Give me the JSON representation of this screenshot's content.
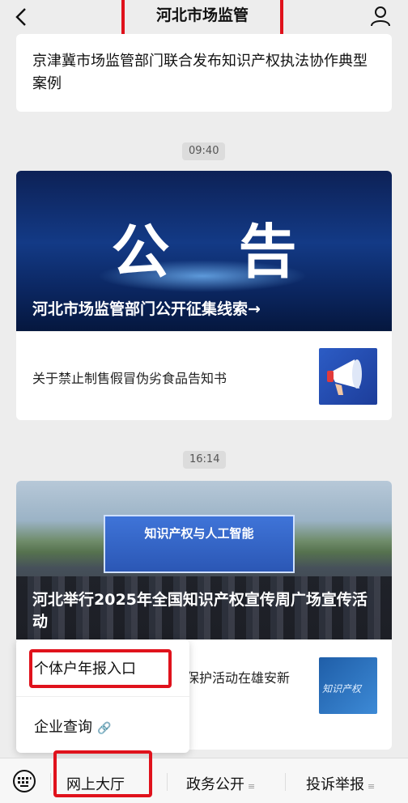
{
  "header": {
    "title": "河北市场监管",
    "back_icon": "back-chevron-icon",
    "user_icon": "user-icon"
  },
  "articles": [
    {
      "title": "京津冀市场监管部门联合发布知识产权执法协作典型案例"
    },
    {
      "time": "09:40",
      "banner_big": "公 告",
      "banner_caption": "河北市场监管部门公开征集线索→",
      "sub_title": "关于禁止制售假冒伪劣食品告知书"
    },
    {
      "time": "16:14",
      "stage_title": "知识产权与人工智能",
      "photo_caption": "河北举行2025年全国知识产权宣传周广场宣传活动",
      "sub_title_visible": "保护活动在雄安新",
      "thumb_text": "知识产权"
    }
  ],
  "popup_menu": {
    "items": [
      "个体户年报入口",
      "企业查询"
    ]
  },
  "bottom_menu": {
    "items": [
      "网上大厅",
      "政务公开",
      "投诉举报"
    ]
  },
  "colors": {
    "highlight": "#e0121c",
    "background": "#ededed"
  }
}
